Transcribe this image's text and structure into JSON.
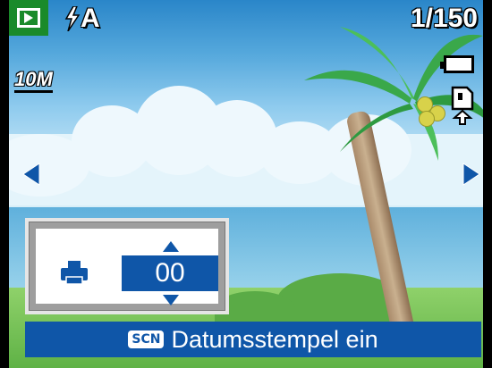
{
  "osd": {
    "mode_icon": "playback-icon",
    "flash_label": "A",
    "flash_icon": "flash-auto-icon",
    "counter": "1/150",
    "resolution": "10M",
    "battery_icon": "battery-icon",
    "memory_card_icon": "memory-card-icon"
  },
  "navigation": {
    "left_icon": "arrow-left-icon",
    "right_icon": "arrow-right-icon"
  },
  "print_panel": {
    "printer_icon": "printer-icon",
    "copies_value": "00",
    "up_icon": "triangle-up-icon",
    "down_icon": "triangle-down-icon"
  },
  "status": {
    "badge": "SCN",
    "text": "Datumsstempel ein"
  },
  "colors": {
    "osd_blue": "#0f56a8",
    "mode_green": "#1a8a2a",
    "panel_gray": "#9e9e9e"
  }
}
